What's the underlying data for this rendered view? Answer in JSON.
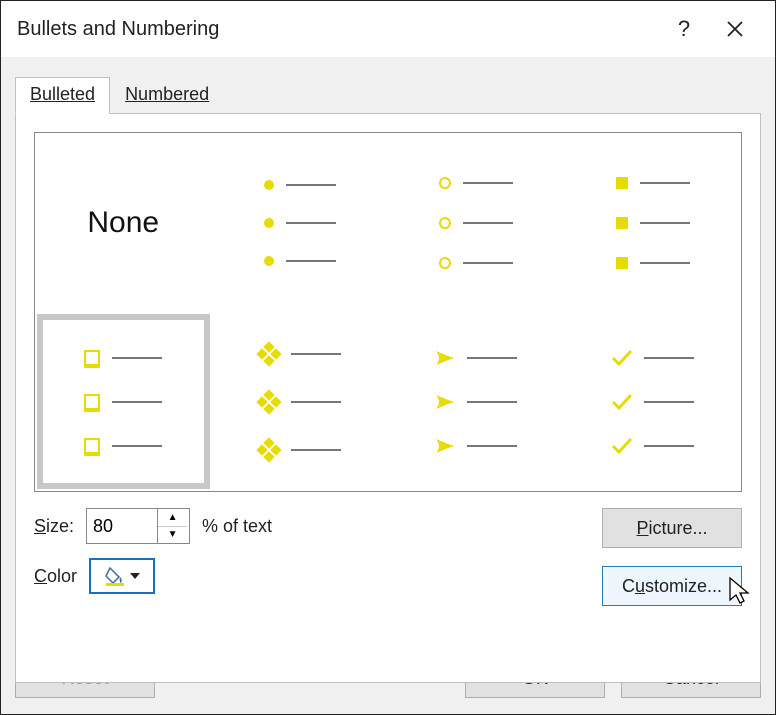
{
  "title": "Bullets and Numbering",
  "tabs": {
    "bulleted": "Bulleted",
    "numbered": "Numbered",
    "active": "bulleted"
  },
  "options": {
    "none_label": "None",
    "selected_index": 4
  },
  "controls": {
    "size_label": "Size:",
    "size_value": "80",
    "pct_text": "% of text",
    "color_label": "Color"
  },
  "buttons": {
    "picture": "Picture...",
    "customize": "Customize...",
    "reset": "Reset",
    "ok": "OK",
    "cancel": "Cancel"
  },
  "colors": {
    "bullet": "#e6dc00"
  }
}
